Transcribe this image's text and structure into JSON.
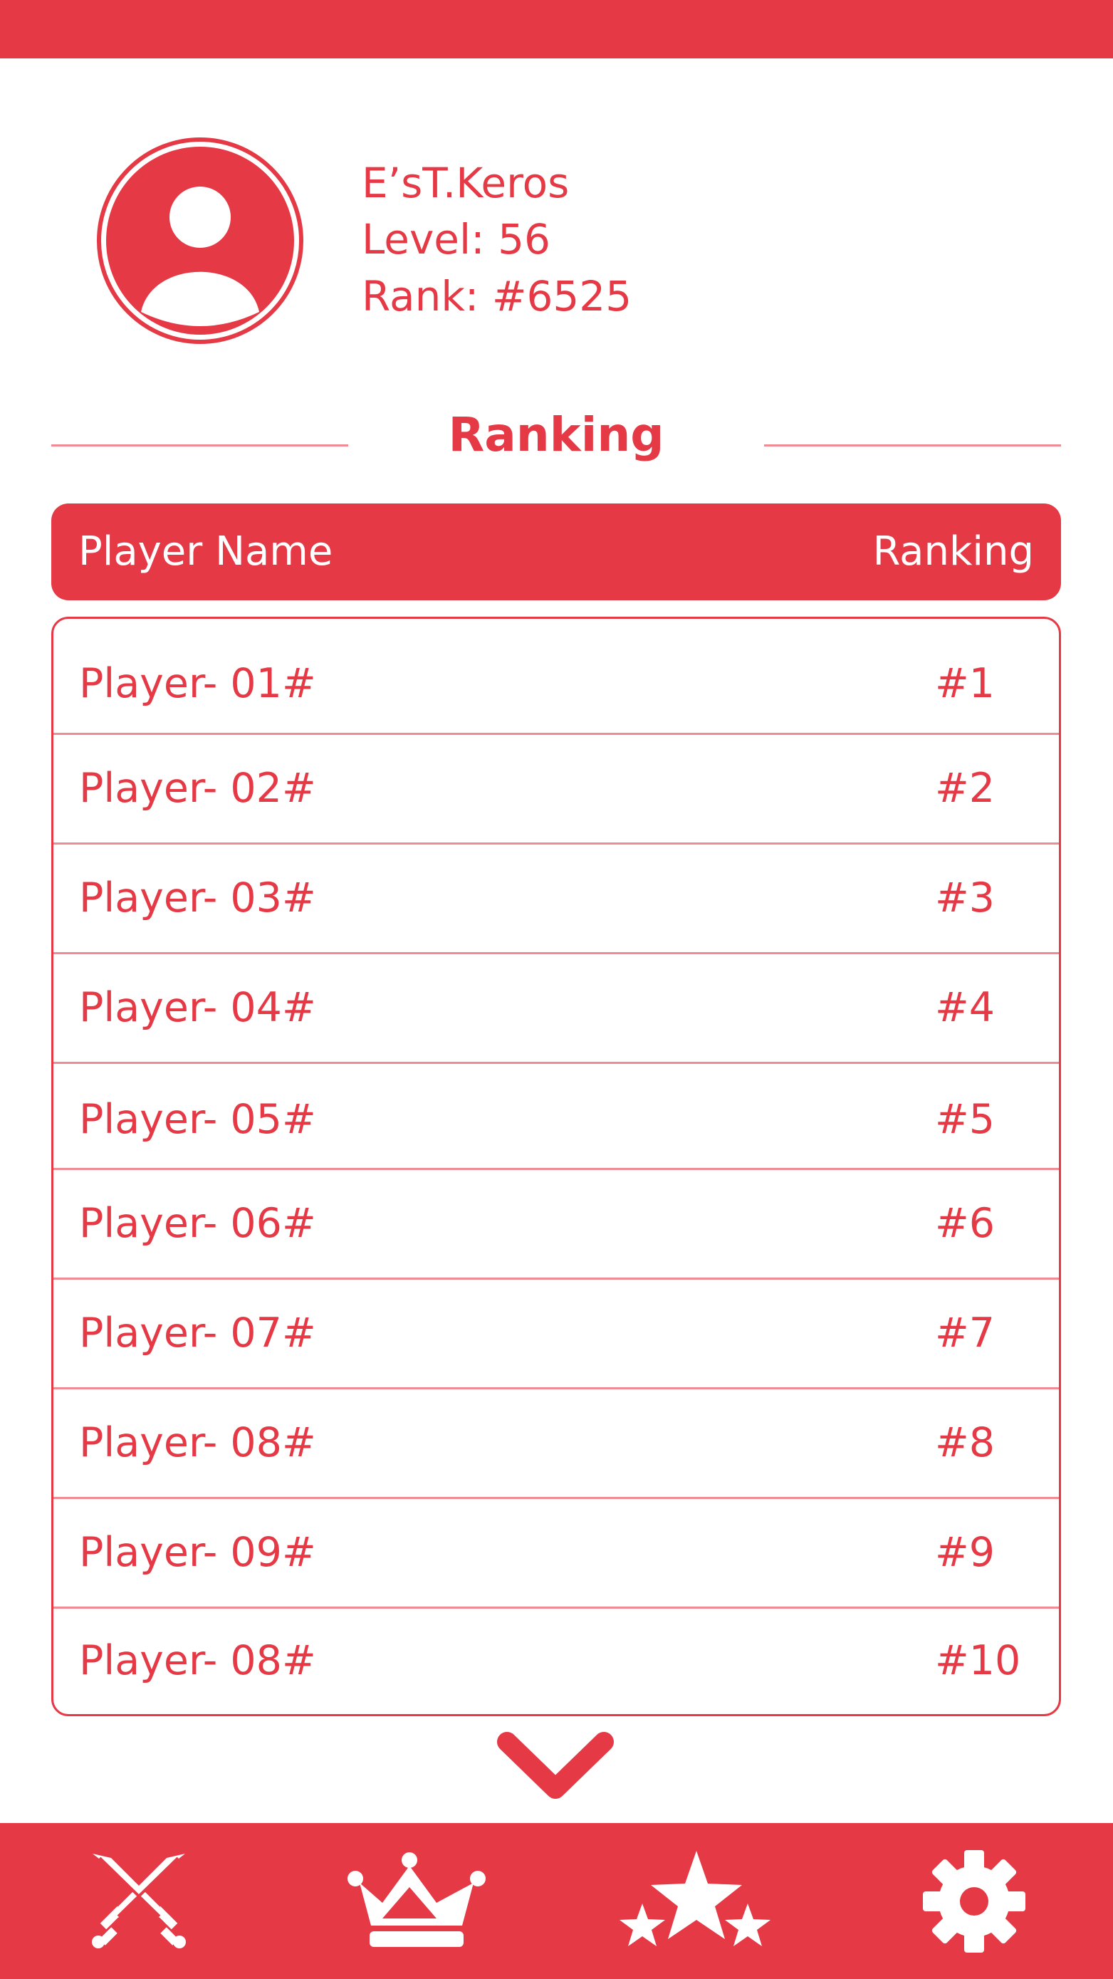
{
  "colors": {
    "accent": "#e63946",
    "divider": "#f08a93",
    "background": "#ffffff"
  },
  "profile": {
    "avatar_icon": "user-avatar-icon",
    "name": "E’sT.Keros",
    "level": "Level: 56",
    "rank": "Rank: #6525"
  },
  "section": {
    "title": "Ranking"
  },
  "table": {
    "headers": {
      "name": "Player Name",
      "ranking": "Ranking"
    },
    "rows": [
      {
        "name": "Player- 01#",
        "rank": "#1"
      },
      {
        "name": "Player- 02#",
        "rank": "#2"
      },
      {
        "name": "Player- 03#",
        "rank": "#3"
      },
      {
        "name": "Player- 04#",
        "rank": "#4"
      },
      {
        "name": "Player- 05#",
        "rank": "#5"
      },
      {
        "name": "Player- 06#",
        "rank": "#6"
      },
      {
        "name": "Player- 07#",
        "rank": "#7"
      },
      {
        "name": "Player- 08#",
        "rank": "#8"
      },
      {
        "name": "Player- 09#",
        "rank": "#9"
      },
      {
        "name": "Player- 08#",
        "rank": "#10"
      }
    ]
  },
  "scroll_more_icon": "chevron-down-icon",
  "bottom_nav": {
    "items": [
      {
        "icon": "crossed-swords-icon"
      },
      {
        "icon": "crown-icon"
      },
      {
        "icon": "stars-icon"
      },
      {
        "icon": "gear-icon"
      }
    ]
  }
}
